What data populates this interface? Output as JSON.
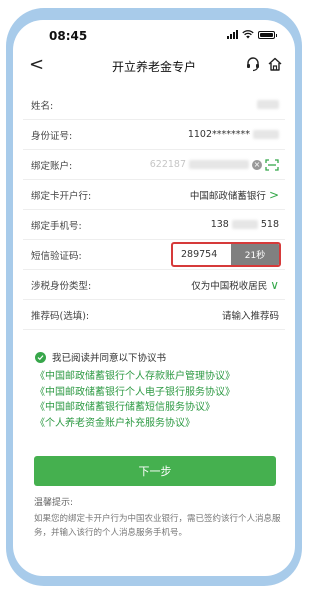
{
  "status_bar": {
    "time": "08:45"
  },
  "nav": {
    "back": "<",
    "title": "开立养老金专户"
  },
  "form": {
    "name_label": "姓名:",
    "id_label": "身份证号:",
    "id_value": "1102********",
    "account_label": "绑定账户:",
    "account_value": "622187",
    "clear_symbol": "×",
    "bank_label": "绑定卡开户行:",
    "bank_value": "中国邮政储蓄银行",
    "chevron": ">",
    "phone_label": "绑定手机号:",
    "phone_prefix": "138",
    "phone_suffix": "518",
    "sms_label": "短信验证码:",
    "sms_value": "289754",
    "sms_timer": "21秒",
    "tax_label": "涉税身份类型:",
    "tax_value": "仅为中国税收居民",
    "tax_chevron": "∨",
    "referral_label": "推荐码(选填):",
    "referral_placeholder": "请输入推荐码"
  },
  "agreement": {
    "check_text": "我已阅读并同意以下协议书",
    "protocols": [
      "《中国邮政储蓄银行个人存款账户管理协议》",
      "《中国邮政储蓄银行个人电子银行服务协议》",
      "《中国邮政储蓄银行储蓄短信服务协议》",
      "《个人养老资金账户补充服务协议》"
    ]
  },
  "next_button": "下一步",
  "tips": {
    "title": "温馨提示:",
    "body": "如果您的绑定卡开户行为中国农业银行，需已签约该行个人消息服务，并输入该行的个人消息服务手机号。"
  },
  "colors": {
    "accent": "#45b04f",
    "protocol": "#2e9a44",
    "highlight": "#d63a3a",
    "frame": "#a8cbea"
  }
}
